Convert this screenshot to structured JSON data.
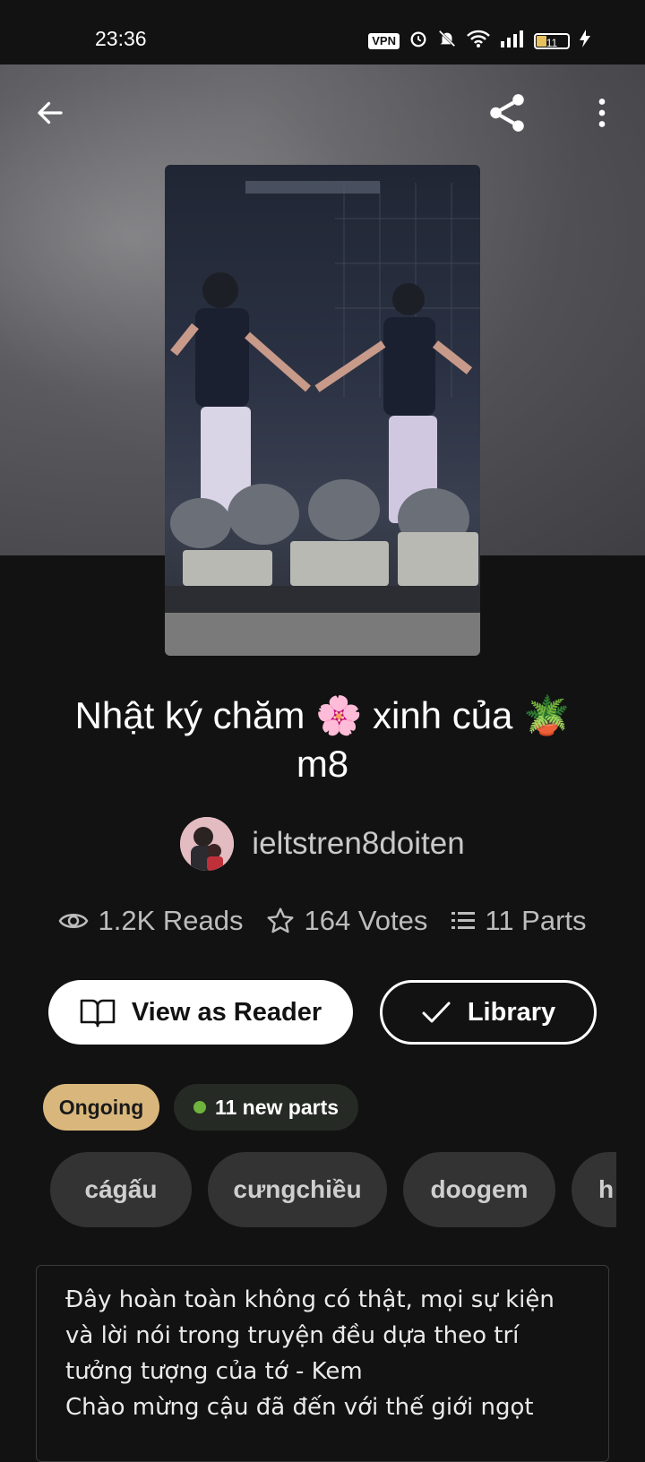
{
  "status_bar": {
    "time": "23:36",
    "vpn": "VPN",
    "battery": "11",
    "icons": [
      "alarm-icon",
      "mute-icon",
      "wifi-icon",
      "signal-icon",
      "battery-icon",
      "charging-icon"
    ]
  },
  "toolbar": {
    "back_icon": "back-arrow-icon",
    "share_icon": "share-icon",
    "more_icon": "more-vert-icon"
  },
  "story": {
    "title_line1": "Nhật ký chăm 🌸 xinh của 🪴",
    "title_line2": "m8",
    "author": "ieltstren8doiten",
    "reads": "1.2K Reads",
    "votes": "164 Votes",
    "parts": "11 Parts"
  },
  "actions": {
    "view_as_reader": "View as Reader",
    "library": "Library"
  },
  "badges": {
    "status": "Ongoing",
    "new_parts": "11 new parts"
  },
  "tags": [
    "cágấu",
    "cưngchiều",
    "doogem",
    "h"
  ],
  "description": {
    "lines": [
      "Đây hoàn toàn không có thật, mọi sự kiện",
      "và lời nói trong truyện đều dựa theo trí",
      "tưởng tượng của tớ - Kem",
      "Chào mừng cậu đã đến với thế giới ngọt"
    ]
  },
  "colors": {
    "background": "#121212",
    "ongoing_badge": "#d9b77c",
    "new_dot": "#6fb33d",
    "tag_bg": "#333333"
  }
}
